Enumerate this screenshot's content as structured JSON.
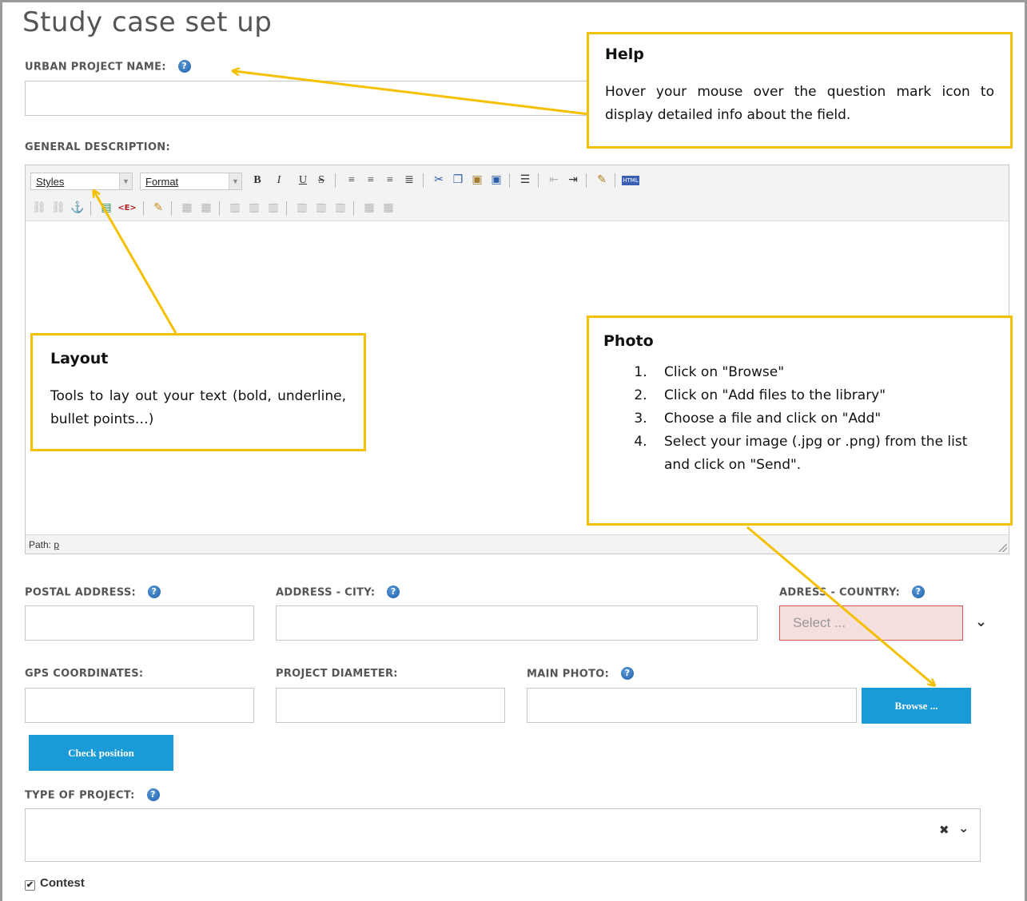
{
  "page": {
    "title": "Study case set up"
  },
  "fields": {
    "urban_project_name": {
      "label": "URBAN PROJECT NAME:",
      "value": ""
    },
    "general_description": {
      "label": "GENERAL DESCRIPTION:"
    },
    "postal_address": {
      "label": "POSTAL ADDRESS:",
      "value": ""
    },
    "address_city": {
      "label": "ADDRESS - CITY:",
      "value": ""
    },
    "address_country": {
      "label": "ADRESS - COUNTRY:",
      "placeholder": "Select ..."
    },
    "gps_coordinates": {
      "label": "GPS COORDINATES:",
      "value": ""
    },
    "project_diameter": {
      "label": "PROJECT DIAMETER:",
      "value": ""
    },
    "main_photo": {
      "label": "MAIN PHOTO:",
      "value": ""
    },
    "type_of_project": {
      "label": "TYPE OF PROJECT:"
    }
  },
  "buttons": {
    "browse": "Browse ...",
    "check_position": "Check position"
  },
  "editor": {
    "styles_combo": "Styles",
    "format_combo": "Format",
    "path_label": "Path:",
    "path_value": "p",
    "toolbar_icons_row1": [
      "bold-icon",
      "italic-icon",
      "underline-icon",
      "strikethrough-icon",
      "align-left-icon",
      "align-center-icon",
      "align-right-icon",
      "align-justify-icon",
      "cut-icon",
      "copy-icon",
      "paste-icon",
      "paste-word-icon",
      "bullet-list-icon",
      "outdent-icon",
      "indent-icon",
      "cleanup-icon",
      "html-source-icon"
    ],
    "toolbar_icons_row2": [
      "link-icon",
      "unlink-icon",
      "anchor-icon",
      "insert-image-icon",
      "insert-element-icon",
      "edit-icon",
      "table-icon",
      "table-props-icon",
      "insert-row-icon",
      "delete-row-icon",
      "insert-col-icon",
      "delete-col-icon",
      "split-cell-icon",
      "merge-cell-icon",
      "table-cell-icon"
    ]
  },
  "contest": {
    "label": "Contest",
    "checked": true
  },
  "callouts": {
    "help": {
      "title": "Help",
      "body": "Hover your mouse over the question mark icon to display detailed info about the field."
    },
    "layout": {
      "title": "Layout",
      "body": "Tools to lay out your text (bold, underline, bullet points…)"
    },
    "photo": {
      "title": "Photo",
      "steps": [
        "Click on \"Browse\"",
        "Click on \"Add files to the library\"",
        "Choose a file and click on \"Add\"",
        "Select your image (.jpg or .png) from the list and click on \"Send\"."
      ]
    }
  },
  "colors": {
    "callout_border": "#f5c000",
    "primary_button": "#1a9ad6",
    "error_field_bg": "#f5dede",
    "error_field_border": "#d9534f",
    "help_icon": "#2d6db5"
  }
}
